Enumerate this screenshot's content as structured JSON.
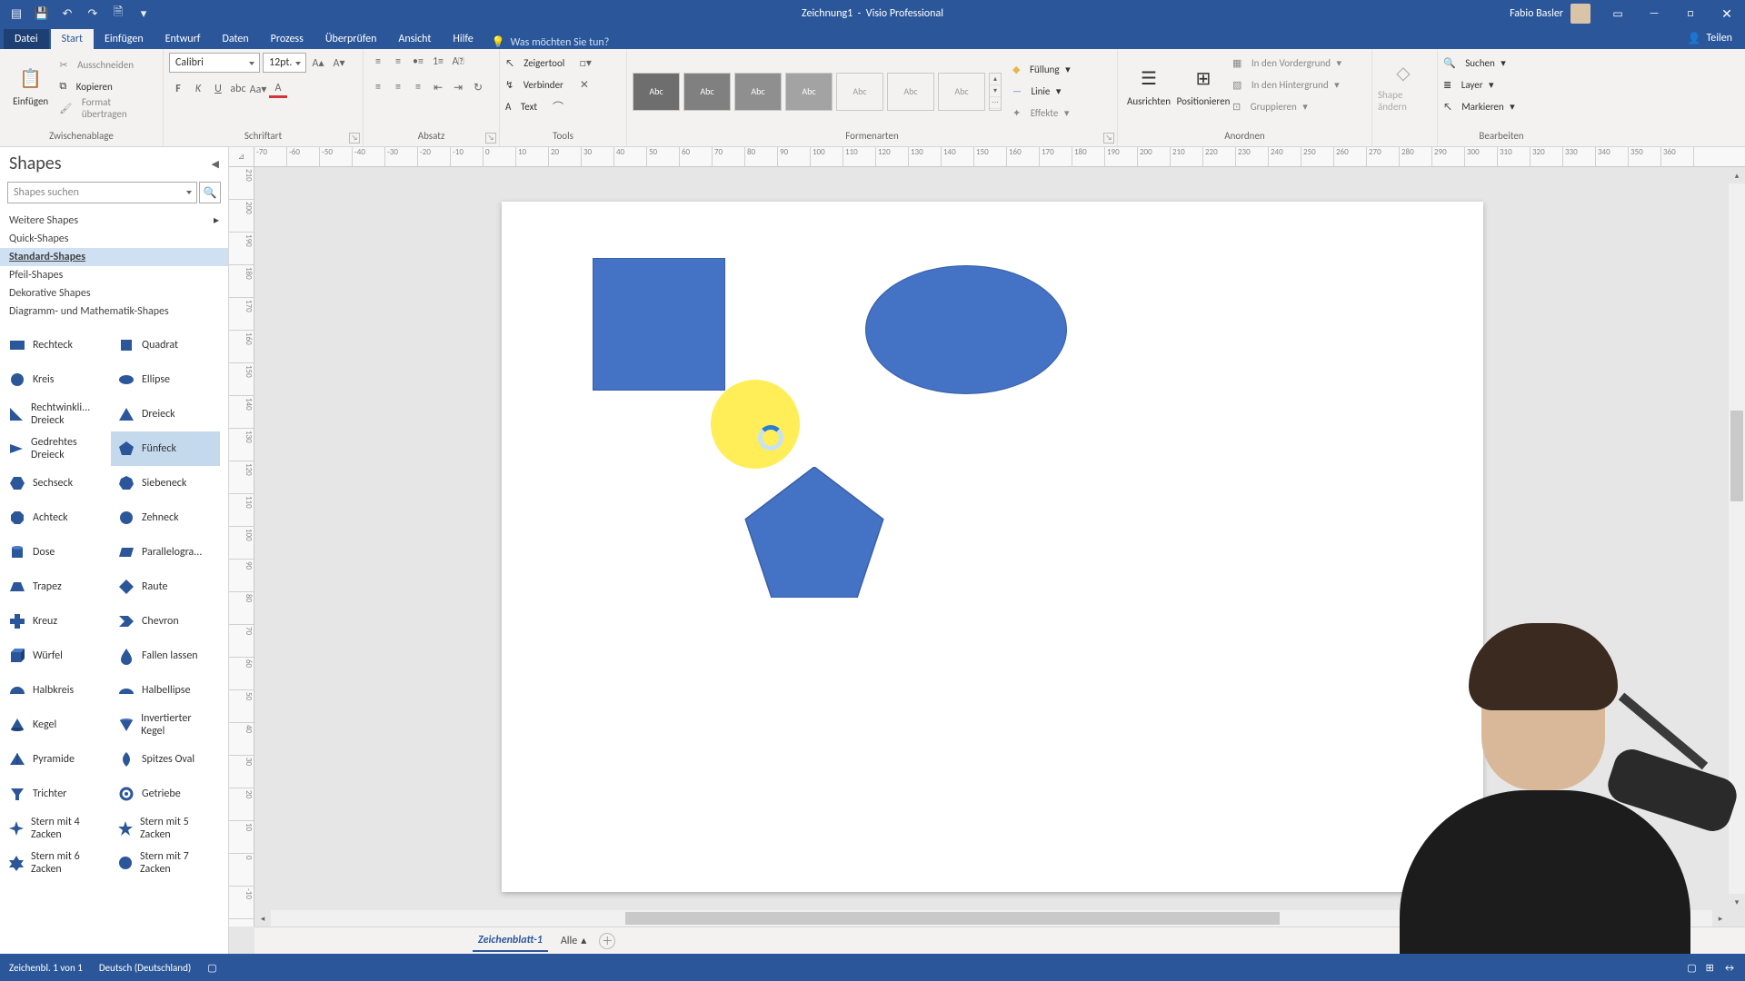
{
  "titlebar": {
    "document": "Zeichnung1",
    "app": "Visio Professional",
    "user": "Fabio Basler"
  },
  "qat": {
    "save": "💾",
    "undo": "↶",
    "redo": "↷",
    "new": "🗎",
    "more": "▾"
  },
  "tabs": {
    "file": "Datei",
    "home": "Start",
    "insert": "Einfügen",
    "design": "Entwurf",
    "data": "Daten",
    "process": "Prozess",
    "review": "Überprüfen",
    "view": "Ansicht",
    "help": "Hilfe",
    "tellme": "Was möchten Sie tun?",
    "share": "Teilen"
  },
  "ribbon": {
    "clipboard": {
      "paste": "Einfügen",
      "cut": "Ausschneiden",
      "copy": "Kopieren",
      "format": "Format übertragen",
      "label": "Zwischenablage"
    },
    "font": {
      "name": "Calibri",
      "size": "12pt.",
      "label": "Schriftart"
    },
    "paragraph": {
      "label": "Absatz"
    },
    "tools": {
      "pointer": "Zeigertool",
      "connector": "Verbinder",
      "text": "Text",
      "label": "Tools"
    },
    "shape_styles": {
      "label": "Formenarten",
      "fill": "Füllung",
      "line": "Linie",
      "effects": "Effekte",
      "swatch": "Abc"
    },
    "arrange": {
      "align": "Ausrichten",
      "position": "Positionieren",
      "front": "In den Vordergrund",
      "back": "In den Hintergrund",
      "group": "Gruppieren",
      "label": "Anordnen"
    },
    "change_shape": {
      "btn": "Shape ändern"
    },
    "edit": {
      "find": "Suchen",
      "layer": "Layer",
      "select": "Markieren",
      "label": "Bearbeiten"
    }
  },
  "shapes_pane": {
    "title": "Shapes",
    "search_placeholder": "Shapes suchen",
    "more": "Weitere Shapes",
    "stencils": [
      "Quick-Shapes",
      "Standard-Shapes",
      "Pfeil-Shapes",
      "Dekorative Shapes",
      "Diagramm- und Mathematik-Shapes"
    ],
    "selected_stencil": "Standard-Shapes",
    "items": [
      {
        "l": "Rechteck",
        "r": "Quadrat"
      },
      {
        "l": "Kreis",
        "r": "Ellipse"
      },
      {
        "l": "Rechtwinkli... Dreieck",
        "r": "Dreieck"
      },
      {
        "l": "Gedrehtes Dreieck",
        "r": "Fünfeck"
      },
      {
        "l": "Sechseck",
        "r": "Siebeneck"
      },
      {
        "l": "Achteck",
        "r": "Zehneck"
      },
      {
        "l": "Dose",
        "r": "Parallelogra..."
      },
      {
        "l": "Trapez",
        "r": "Raute"
      },
      {
        "l": "Kreuz",
        "r": "Chevron"
      },
      {
        "l": "Würfel",
        "r": "Fallen lassen"
      },
      {
        "l": "Halbkreis",
        "r": "Halbellipse"
      },
      {
        "l": "Kegel",
        "r": "Invertierter Kegel"
      },
      {
        "l": "Pyramide",
        "r": "Spitzes Oval"
      },
      {
        "l": "Trichter",
        "r": "Getriebe"
      },
      {
        "l": "Stern mit 4 Zacken",
        "r": "Stern mit 5 Zacken"
      },
      {
        "l": "Stern mit 6 Zacken",
        "r": "Stern mit 7 Zacken"
      }
    ],
    "selected_item": "Fünfeck"
  },
  "ruler_h": [
    "-70",
    "-60",
    "-50",
    "-40",
    "-30",
    "-20",
    "-10",
    "0",
    "10",
    "20",
    "30",
    "40",
    "50",
    "60",
    "70",
    "80",
    "90",
    "100",
    "110",
    "120",
    "130",
    "140",
    "150",
    "160",
    "170",
    "180",
    "190",
    "200",
    "210",
    "220",
    "230",
    "240",
    "250",
    "260",
    "270",
    "280",
    "290",
    "300",
    "310",
    "320",
    "330",
    "340",
    "350",
    "360"
  ],
  "ruler_v": [
    "210",
    "200",
    "190",
    "180",
    "170",
    "160",
    "150",
    "140",
    "130",
    "120",
    "110",
    "100",
    "90",
    "80",
    "70",
    "60",
    "50",
    "40",
    "30",
    "20",
    "10",
    "0",
    "-10"
  ],
  "sheets": {
    "active": "Zeichenblatt-1",
    "all": "Alle"
  },
  "status": {
    "page": "Zeichenbl. 1 von 1",
    "lang": "Deutsch (Deutschland)"
  }
}
